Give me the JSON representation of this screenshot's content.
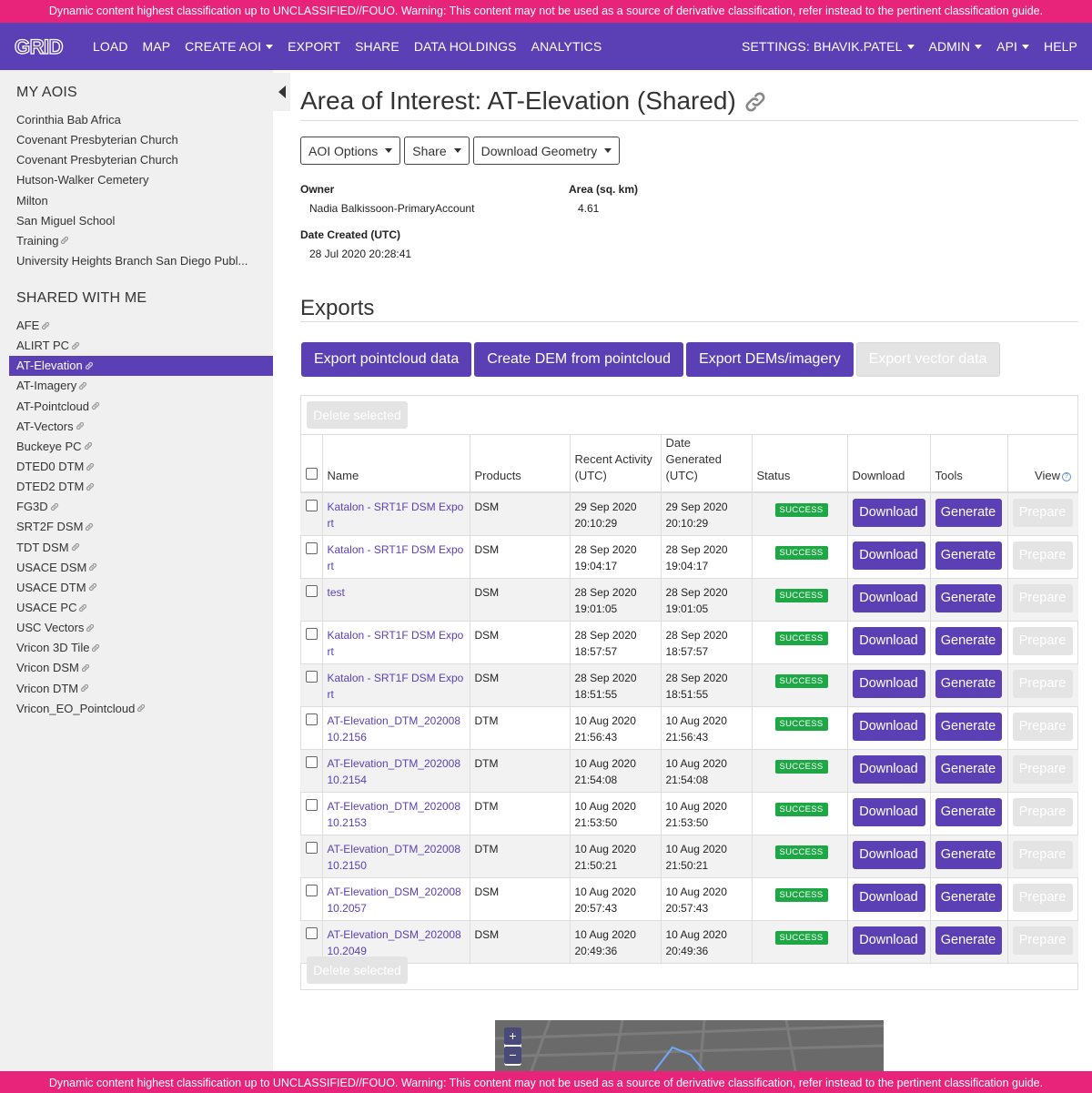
{
  "classification_banner": "Dynamic content highest classification up to UNCLASSIFIED//FOUO. Warning: This content may not be used as a source of derivative classification, refer instead to the pertinent classification guide.",
  "brand": {
    "logo_text": "GRID"
  },
  "nav": {
    "left": [
      {
        "label": "LOAD",
        "dropdown": false
      },
      {
        "label": "MAP",
        "dropdown": false
      },
      {
        "label": "CREATE AOI",
        "dropdown": true
      },
      {
        "label": "EXPORT",
        "dropdown": false
      },
      {
        "label": "SHARE",
        "dropdown": false
      },
      {
        "label": "DATA HOLDINGS",
        "dropdown": false
      },
      {
        "label": "ANALYTICS",
        "dropdown": false
      }
    ],
    "right": [
      {
        "label": "SETTINGS: BHAVIK.PATEL",
        "dropdown": true
      },
      {
        "label": "ADMIN",
        "dropdown": true
      },
      {
        "label": "API",
        "dropdown": true
      },
      {
        "label": "HELP",
        "dropdown": false
      }
    ]
  },
  "sidebar": {
    "my_aois_heading": "MY AOIS",
    "my_aois": [
      {
        "label": "Corinthia Bab Africa",
        "shared": false
      },
      {
        "label": "Covenant Presbyterian Church",
        "shared": false
      },
      {
        "label": "Covenant Presbyterian Church",
        "shared": false
      },
      {
        "label": "Hutson-Walker Cemetery",
        "shared": false
      },
      {
        "label": "Milton",
        "shared": false
      },
      {
        "label": "San Miguel School",
        "shared": false
      },
      {
        "label": "Training",
        "shared": true
      },
      {
        "label": "University Heights Branch San Diego Publ...",
        "shared": false
      }
    ],
    "shared_heading": "SHARED WITH ME",
    "shared": [
      {
        "label": "AFE",
        "active": false
      },
      {
        "label": "ALIRT PC",
        "active": false
      },
      {
        "label": "AT-Elevation",
        "active": true
      },
      {
        "label": "AT-Imagery",
        "active": false
      },
      {
        "label": "AT-Pointcloud",
        "active": false
      },
      {
        "label": "AT-Vectors",
        "active": false
      },
      {
        "label": "Buckeye PC",
        "active": false
      },
      {
        "label": "DTED0 DTM",
        "active": false
      },
      {
        "label": "DTED2 DTM",
        "active": false
      },
      {
        "label": "FG3D",
        "active": false
      },
      {
        "label": "SRT2F DSM",
        "active": false
      },
      {
        "label": "TDT DSM",
        "active": false
      },
      {
        "label": "USACE DSM",
        "active": false
      },
      {
        "label": "USACE DTM",
        "active": false
      },
      {
        "label": "USACE PC",
        "active": false
      },
      {
        "label": "USC Vectors",
        "active": false
      },
      {
        "label": "Vricon 3D Tile",
        "active": false
      },
      {
        "label": "Vricon DSM",
        "active": false
      },
      {
        "label": "Vricon DTM",
        "active": false
      },
      {
        "label": "Vricon_EO_Pointcloud",
        "active": false
      }
    ]
  },
  "aoi": {
    "title": "Area of Interest: AT-Elevation (Shared)",
    "buttons": {
      "options": "AOI Options",
      "share": "Share",
      "download_geometry": "Download Geometry"
    },
    "owner_label": "Owner",
    "owner": "Nadia Balkissoon-PrimaryAccount",
    "area_label": "Area (sq. km)",
    "area": "4.61",
    "date_label": "Date Created (UTC)",
    "date_created": "28 Jul 2020 20:28:41"
  },
  "exports": {
    "heading": "Exports",
    "buttons": [
      {
        "label": "Export pointcloud data",
        "enabled": true
      },
      {
        "label": "Create DEM from pointcloud",
        "enabled": true
      },
      {
        "label": "Export DEMs/imagery",
        "enabled": true
      },
      {
        "label": "Export vector data",
        "enabled": false
      }
    ],
    "delete_selected": "Delete selected",
    "columns": {
      "name": "Name",
      "products": "Products",
      "recent": "Recent Activity (UTC)",
      "generated": "Date Generated (UTC)",
      "status": "Status",
      "download": "Download",
      "tools": "Tools",
      "view": "View"
    },
    "actions": {
      "download": "Download",
      "generate": "Generate",
      "prepare": "Prepare"
    },
    "rows": [
      {
        "name": "Katalon - SRT1F DSM Export",
        "product": "DSM",
        "recent": "29 Sep 2020 20:10:29",
        "generated": "29 Sep 2020 20:10:29",
        "status": "SUCCESS"
      },
      {
        "name": "Katalon - SRT1F DSM Export",
        "product": "DSM",
        "recent": "28 Sep 2020 19:04:17",
        "generated": "28 Sep 2020 19:04:17",
        "status": "SUCCESS"
      },
      {
        "name": "test",
        "product": "DSM",
        "recent": "28 Sep 2020 19:01:05",
        "generated": "28 Sep 2020 19:01:05",
        "status": "SUCCESS"
      },
      {
        "name": "Katalon - SRT1F DSM Export",
        "product": "DSM",
        "recent": "28 Sep 2020 18:57:57",
        "generated": "28 Sep 2020 18:57:57",
        "status": "SUCCESS"
      },
      {
        "name": "Katalon - SRT1F DSM Export",
        "product": "DSM",
        "recent": "28 Sep 2020 18:51:55",
        "generated": "28 Sep 2020 18:51:55",
        "status": "SUCCESS"
      },
      {
        "name": "AT-Elevation_DTM_20200810.2156",
        "product": "DTM",
        "recent": "10 Aug 2020 21:56:43",
        "generated": "10 Aug 2020 21:56:43",
        "status": "SUCCESS"
      },
      {
        "name": "AT-Elevation_DTM_20200810.2154",
        "product": "DTM",
        "recent": "10 Aug 2020 21:54:08",
        "generated": "10 Aug 2020 21:54:08",
        "status": "SUCCESS"
      },
      {
        "name": "AT-Elevation_DTM_20200810.2153",
        "product": "DTM",
        "recent": "10 Aug 2020 21:53:50",
        "generated": "10 Aug 2020 21:53:50",
        "status": "SUCCESS"
      },
      {
        "name": "AT-Elevation_DTM_20200810.2150",
        "product": "DTM",
        "recent": "10 Aug 2020 21:50:21",
        "generated": "10 Aug 2020 21:50:21",
        "status": "SUCCESS"
      },
      {
        "name": "AT-Elevation_DSM_20200810.2057",
        "product": "DSM",
        "recent": "10 Aug 2020 20:57:43",
        "generated": "10 Aug 2020 20:57:43",
        "status": "SUCCESS"
      },
      {
        "name": "AT-Elevation_DSM_20200810.2049",
        "product": "DSM",
        "recent": "10 Aug 2020 20:49:36",
        "generated": "10 Aug 2020 20:49:36",
        "status": "SUCCESS"
      }
    ]
  },
  "map": {
    "zoom_in": "+",
    "zoom_out": "−"
  },
  "icons": {
    "share_link": "link-icon",
    "help": "help-icon",
    "collapse": "chevron-left-icon"
  },
  "colors": {
    "brand": "#5b3fb4",
    "classification": "#e8237a",
    "success": "#1ea845"
  }
}
